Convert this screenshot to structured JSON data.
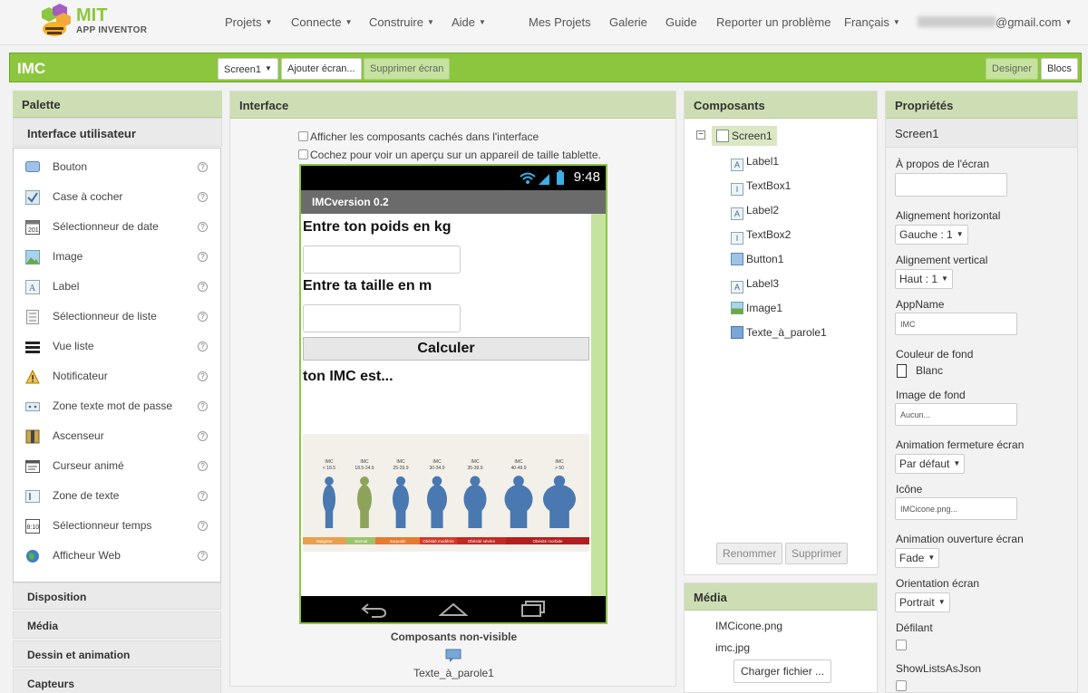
{
  "brand": {
    "name": "MIT",
    "subtitle": "APP INVENTOR"
  },
  "topnav": {
    "menus": [
      {
        "label": "Projets"
      },
      {
        "label": "Connecte"
      },
      {
        "label": "Construire"
      },
      {
        "label": "Aide"
      }
    ],
    "links": [
      {
        "label": "Mes Projets"
      },
      {
        "label": "Galerie"
      },
      {
        "label": "Guide"
      },
      {
        "label": "Reporter un problème"
      }
    ],
    "language": "Français",
    "email_domain": "@gmail.com"
  },
  "project_bar": {
    "title": "IMC",
    "screen_select": "Screen1",
    "add_screen": "Ajouter écran...",
    "remove_screen": "Supprimer écran",
    "designer": "Designer",
    "blocks": "Blocs"
  },
  "palette": {
    "header": "Palette",
    "open_category": "Interface utilisateur",
    "items": [
      {
        "label": "Bouton",
        "icon": "button-icon"
      },
      {
        "label": "Case à cocher",
        "icon": "checkbox-icon"
      },
      {
        "label": "Sélectionneur de date",
        "icon": "calendar-icon"
      },
      {
        "label": "Image",
        "icon": "image-icon"
      },
      {
        "label": "Label",
        "icon": "label-icon"
      },
      {
        "label": "Sélectionneur de liste",
        "icon": "list-picker-icon"
      },
      {
        "label": "Vue liste",
        "icon": "list-view-icon"
      },
      {
        "label": "Notificateur",
        "icon": "warning-icon"
      },
      {
        "label": "Zone texte mot de passe",
        "icon": "password-icon"
      },
      {
        "label": "Ascenseur",
        "icon": "slider-icon"
      },
      {
        "label": "Curseur animé",
        "icon": "spinner-icon"
      },
      {
        "label": "Zone de texte",
        "icon": "textbox-icon"
      },
      {
        "label": "Sélectionneur temps",
        "icon": "clock-icon"
      },
      {
        "label": "Afficheur Web",
        "icon": "globe-icon"
      }
    ],
    "help_glyph": "?",
    "categories": [
      {
        "label": "Disposition"
      },
      {
        "label": "Média"
      },
      {
        "label": "Dessin et animation"
      },
      {
        "label": "Capteurs"
      }
    ]
  },
  "viewer": {
    "header": "Interface",
    "show_hidden": "Afficher les composants cachés dans l'interface",
    "tablet_preview": "Cochez pour voir un aperçu sur un appareil de taille tablette.",
    "phone": {
      "time": "9:48",
      "app_title": "IMCversion 0.2",
      "label1": "Entre ton poids en kg",
      "label2": "Entre ta taille en m",
      "button": "Calculer",
      "label3": "ton IMC est...",
      "bmi_image": {
        "categories": [
          "IMC\n< 18.5",
          "IMC\n18.5-24.9",
          "IMC\n25-29.9",
          "IMC\n30-34.9",
          "IMC\n35-39.9",
          "IMC\n40-49.9",
          "IMC\n> 50"
        ],
        "bands": [
          "Maigreur",
          "Normal",
          "Surpoids",
          "Obésité modérée",
          "Obésité sévère",
          "Obésité morbide"
        ]
      }
    },
    "nonvisible_title": "Composants non-visible",
    "nonvisible_items": [
      "Texte_à_parole1"
    ]
  },
  "components": {
    "header": "Composants",
    "root": "Screen1",
    "children": [
      {
        "label": "Label1",
        "icon": "label-icon"
      },
      {
        "label": "TextBox1",
        "icon": "textbox-icon"
      },
      {
        "label": "Label2",
        "icon": "label-icon"
      },
      {
        "label": "TextBox2",
        "icon": "textbox-icon"
      },
      {
        "label": "Button1",
        "icon": "button-icon"
      },
      {
        "label": "Label3",
        "icon": "label-icon"
      },
      {
        "label": "Image1",
        "icon": "image-icon"
      },
      {
        "label": "Texte_à_parole1",
        "icon": "speech-icon"
      }
    ],
    "rename": "Renommer",
    "delete": "Supprimer"
  },
  "media": {
    "header": "Média",
    "files": [
      "IMCicone.png",
      "imc.jpg"
    ],
    "upload": "Charger fichier ..."
  },
  "properties": {
    "header": "Propriétés",
    "component": "Screen1",
    "about_label": "À propos de l'écran",
    "about_value": "",
    "align_h_label": "Alignement horizontal",
    "align_h_value": "Gauche : 1",
    "align_v_label": "Alignement vertical",
    "align_v_value": "Haut : 1",
    "appname_label": "AppName",
    "appname_value": "IMC",
    "bgcolor_label": "Couleur de fond",
    "bgcolor_value": "Blanc",
    "bgimage_label": "Image de fond",
    "bgimage_value": "Aucun...",
    "close_anim_label": "Animation fermeture écran",
    "close_anim_value": "Par défaut",
    "icon_label": "Icône",
    "icon_value": "IMCicone.png...",
    "open_anim_label": "Animation ouverture écran",
    "open_anim_value": "Fade",
    "orientation_label": "Orientation écran",
    "orientation_value": "Portrait",
    "scrollable_label": "Défilant",
    "showlists_label": "ShowListsAsJson"
  },
  "colors": {
    "accent": "#8cc63e",
    "header_bg": "#cedeb4",
    "phone_title": "#6b6b6b"
  }
}
